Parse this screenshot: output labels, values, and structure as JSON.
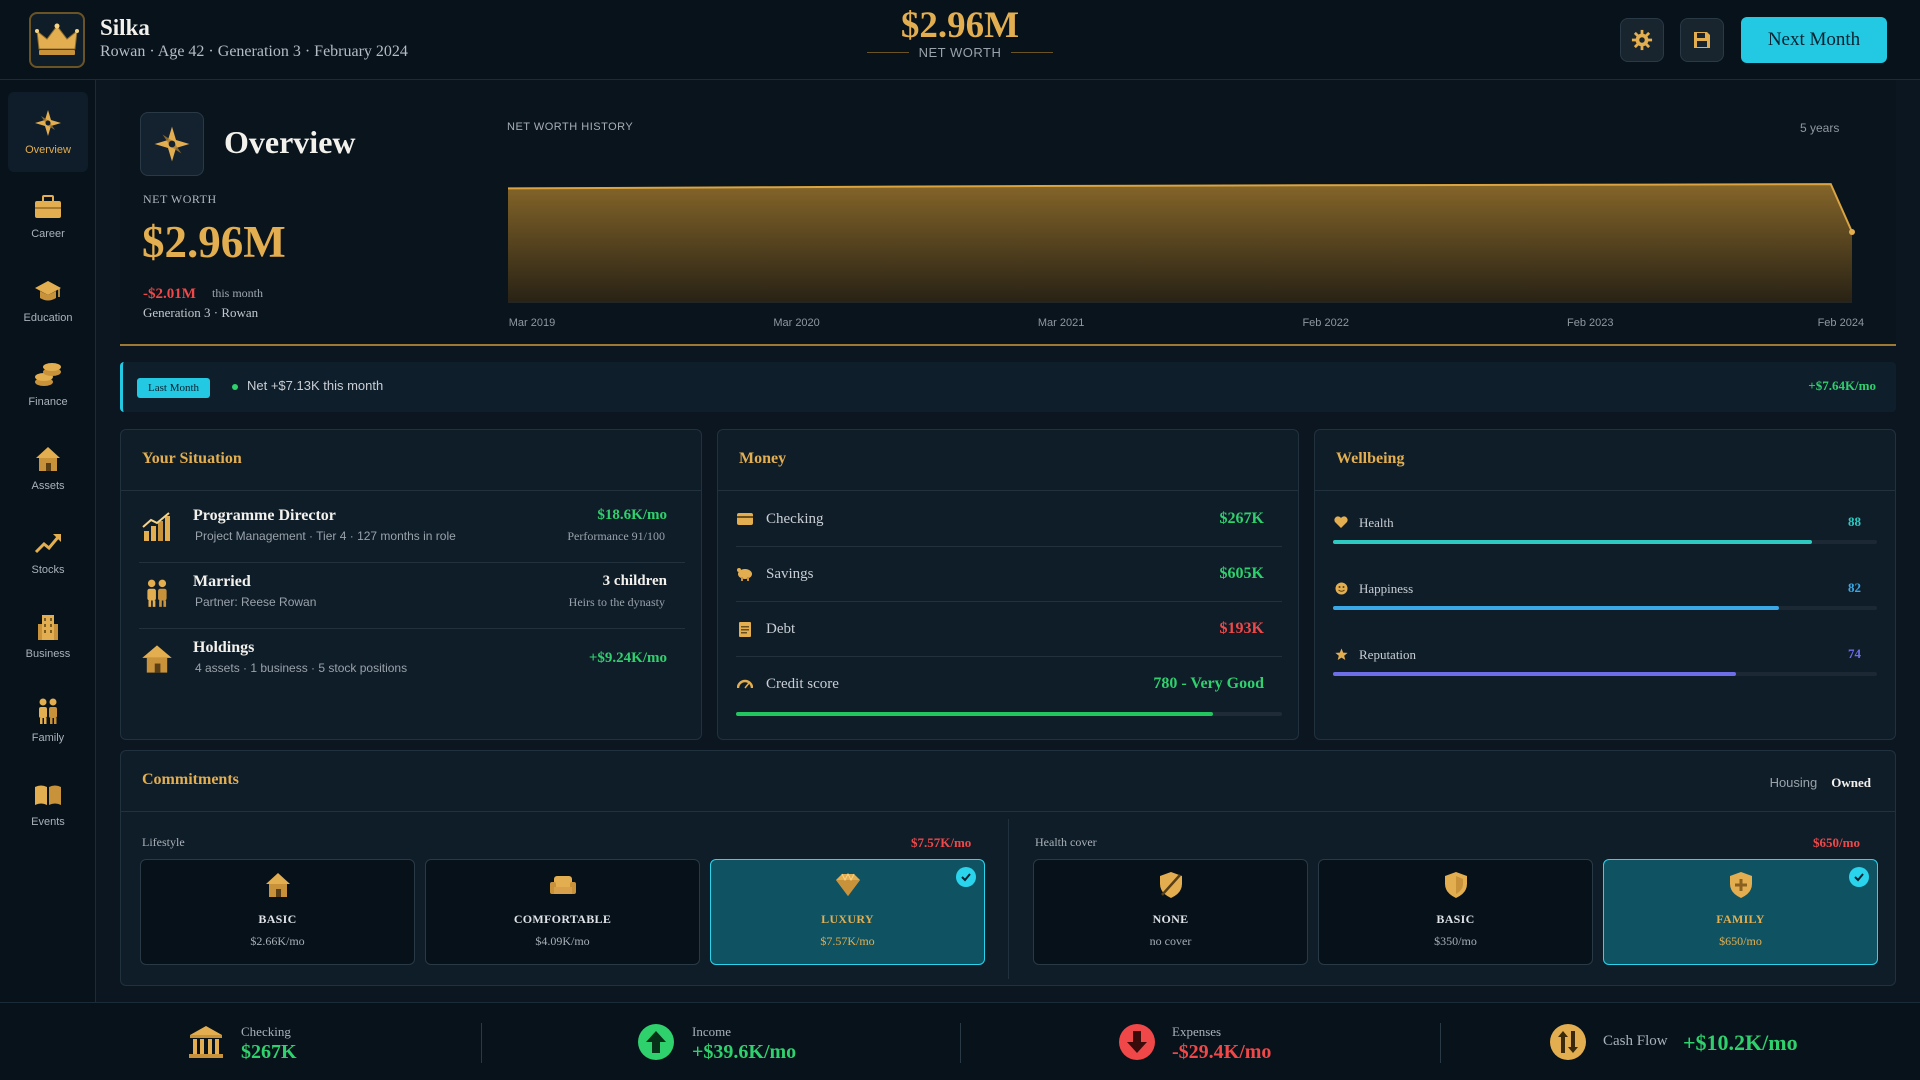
{
  "header": {
    "title": "Silka",
    "subtitle": "Rowan · Age 42 · Generation 3 · February 2024",
    "net_worth": "$2.96M",
    "net_worth_label": "NET WORTH",
    "next_button": "Next Month",
    "settings_icon": "gear-icon",
    "save_icon": "floppy-disk-icon"
  },
  "sidebar": {
    "items": [
      {
        "label": "Overview",
        "icon": "compass-icon",
        "active": true
      },
      {
        "label": "Career",
        "icon": "briefcase-icon"
      },
      {
        "label": "Education",
        "icon": "graduation-cap-icon"
      },
      {
        "label": "Finance",
        "icon": "coins-icon"
      },
      {
        "label": "Assets",
        "icon": "house-icon"
      },
      {
        "label": "Stocks",
        "icon": "trend-up-icon"
      },
      {
        "label": "Business",
        "icon": "building-icon"
      },
      {
        "label": "Family",
        "icon": "family-icon"
      },
      {
        "label": "Events",
        "icon": "book-icon"
      }
    ]
  },
  "overview": {
    "title": "Overview",
    "net_worth_label": "NET WORTH",
    "net_worth": "$2.96M",
    "delta": "-$2.01M",
    "delta_label": "this month",
    "generation": "Generation 3 · Rowan",
    "chart_title": "NET WORTH HISTORY",
    "chart_range": "5 years"
  },
  "chart_data": {
    "type": "area",
    "title": "NET WORTH HISTORY",
    "x_ticks": [
      "Mar 2019",
      "Mar 2020",
      "Mar 2021",
      "Feb 2022",
      "Feb 2023",
      "Feb 2024"
    ],
    "x": [
      0,
      1,
      2,
      3,
      4,
      5,
      5.08
    ],
    "values": [
      4.8,
      4.85,
      4.9,
      4.93,
      4.95,
      4.98,
      2.96
    ],
    "ylim": [
      0,
      6
    ],
    "unit": "$M",
    "grid": false,
    "color": "#d9a441"
  },
  "banner": {
    "badge": "Last Month",
    "text": "Net +$7.13K this month",
    "right": "+$7.64K/mo"
  },
  "situation": {
    "title": "Your Situation",
    "rows": [
      {
        "title": "Programme Director",
        "sub": "Project Management · Tier 4 · 127 months in role",
        "value": "$18.6K/mo",
        "sub2": "Performance 91/100",
        "icon": "bar-chart-icon"
      },
      {
        "title": "Married",
        "sub": "Partner: Reese Rowan",
        "value": "3 children",
        "sub2": "Heirs to the dynasty",
        "icon": "couple-icon"
      },
      {
        "title": "Holdings",
        "sub": "4 assets · 1 business · 5 stock positions",
        "value": "+$9.24K/mo",
        "sub2": "",
        "icon": "house-icon"
      }
    ]
  },
  "money": {
    "title": "Money",
    "rows": [
      {
        "label": "Checking",
        "value": "$267K",
        "icon": "card-icon"
      },
      {
        "label": "Savings",
        "value": "$605K",
        "icon": "piggy-bank-icon"
      },
      {
        "label": "Debt",
        "value": "$193K",
        "icon": "document-icon"
      },
      {
        "label": "Credit score",
        "value": "780 - Very Good",
        "icon": "gauge-icon"
      }
    ],
    "credit_fraction": 0.874
  },
  "wellbeing": {
    "title": "Wellbeing",
    "rows": [
      {
        "label": "Health",
        "value": "88",
        "icon": "heart-icon",
        "color": "#2ec9c1",
        "fraction": 0.88
      },
      {
        "label": "Happiness",
        "value": "82",
        "icon": "smiley-icon",
        "color": "#3aa8e6",
        "fraction": 0.82
      },
      {
        "label": "Reputation",
        "value": "74",
        "icon": "star-icon",
        "color": "#6d6ee8",
        "fraction": 0.74
      }
    ]
  },
  "commitments": {
    "title": "Commitments",
    "tabs": [
      "Housing",
      "Owned"
    ],
    "lifestyle": {
      "label": "Lifestyle",
      "value": "$7.57K/mo",
      "options": [
        {
          "name": "BASIC",
          "price": "$2.66K/mo",
          "icon": "house-icon",
          "selected": false
        },
        {
          "name": "COMFORTABLE",
          "price": "$4.09K/mo",
          "icon": "sofa-icon",
          "selected": false
        },
        {
          "name": "LUXURY",
          "price": "$7.57K/mo",
          "icon": "diamond-icon",
          "selected": true
        }
      ]
    },
    "health": {
      "label": "Health cover",
      "value": "$650/mo",
      "options": [
        {
          "name": "NONE",
          "price": "no cover",
          "icon": "shield-slash-icon",
          "selected": false
        },
        {
          "name": "BASIC",
          "price": "$350/mo",
          "icon": "shield-icon",
          "selected": false
        },
        {
          "name": "FAMILY",
          "price": "$650/mo",
          "icon": "shield-plus-icon",
          "selected": true
        }
      ]
    }
  },
  "footer": {
    "checking_label": "Checking",
    "checking": "$267K",
    "income_label": "Income",
    "income": "+$39.6K/mo",
    "expenses_label": "Expenses",
    "expenses": "-$29.4K/mo",
    "cashflow_label": "Cash Flow",
    "cashflow": "+$10.2K/mo"
  },
  "colors": {
    "gold": "#e3ae4f",
    "cyan": "#23c9e3",
    "positive": "#2fd16d",
    "negative": "#f04848"
  }
}
